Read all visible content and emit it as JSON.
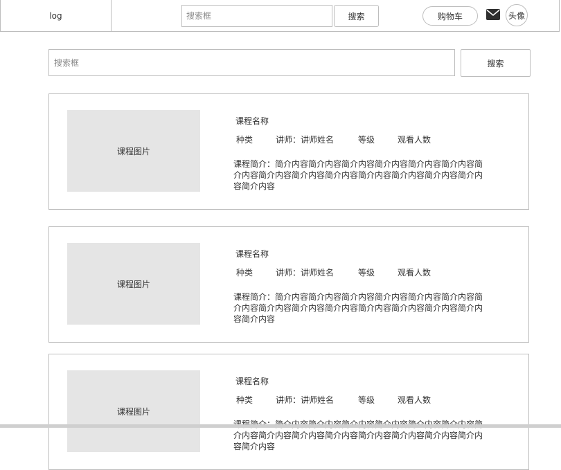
{
  "header": {
    "logo": "log",
    "search_placeholder": "搜索框",
    "search_button": "搜索",
    "cart_button": "购物车",
    "mail_icon": "mail-icon",
    "avatar": "头像"
  },
  "search": {
    "placeholder": "搜索框",
    "button": "搜索"
  },
  "courses": [
    {
      "image_label": "课程图片",
      "name": "课程名称",
      "type": "种类",
      "teacher": "讲师：讲师姓名",
      "level": "等级",
      "views": "观看人数",
      "description": "课程简介：简介内容简介内容简介内容简介内容简介内容简介内容简介内容简介内容简介内容简介内容简介内容简介内容简介内容简介内容简介内容"
    },
    {
      "image_label": "课程图片",
      "name": "课程名称",
      "type": "种类",
      "teacher": "讲师：讲师姓名",
      "level": "等级",
      "views": "观看人数",
      "description": "课程简介：简介内容简介内容简介内容简介内容简介内容简介内容简介内容简介内容简介内容简介内容简介内容简介内容简介内容简介内容简介内容"
    },
    {
      "image_label": "课程图片",
      "name": "课程名称",
      "type": "种类",
      "teacher": "讲师：讲师姓名",
      "level": "等级",
      "views": "观看人数",
      "description": "课程简介：简介内容简介内容简介内容简介内容简介内容简介内容简介内容简介内容简介内容简介内容简介内容简介内容简介内容简介内容简介内容"
    }
  ]
}
